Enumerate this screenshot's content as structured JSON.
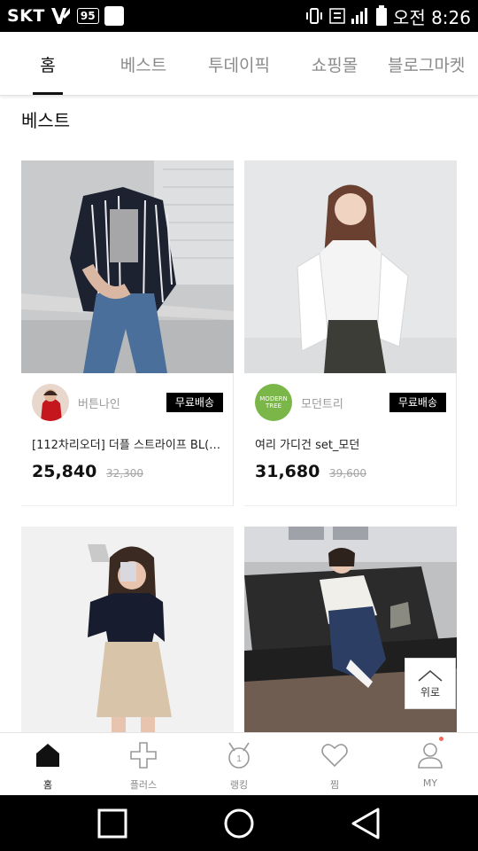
{
  "status_bar": {
    "carrier": "SKT",
    "badge": "95",
    "time": "오전 8:26"
  },
  "tabs": [
    {
      "label": "홈",
      "active": true
    },
    {
      "label": "베스트",
      "active": false
    },
    {
      "label": "투데이픽",
      "active": false
    },
    {
      "label": "쇼핑몰",
      "active": false
    },
    {
      "label": "블로그마켓",
      "active": false
    }
  ],
  "section": {
    "title": "베스트"
  },
  "products": [
    {
      "store": "버튼나인",
      "shipping": "무료배송",
      "name": "[112차리오더] 더플 스트라이프 BL(자…",
      "price": "25,840",
      "original_price": "32,300"
    },
    {
      "store": "모던트리",
      "store_logo_text": "MODERN TREE",
      "shipping": "무료배송",
      "name": "여리 가디건 set_모던",
      "price": "31,680",
      "original_price": "39,600"
    }
  ],
  "to_top": {
    "label": "위로"
  },
  "bottom_nav": [
    {
      "label": "홈",
      "icon": "home-icon",
      "active": true
    },
    {
      "label": "플러스",
      "icon": "plus-icon",
      "active": false
    },
    {
      "label": "랭킹",
      "icon": "ranking-medal-icon",
      "active": false,
      "medal_number": "1"
    },
    {
      "label": "찜",
      "icon": "heart-icon",
      "active": false
    },
    {
      "label": "MY",
      "icon": "person-icon",
      "active": false,
      "has_notification": true
    }
  ],
  "colors": {
    "accent": "#111111",
    "inactive_tab": "#8b8b8b",
    "notification_dot": "#f26b5a",
    "store_green": "#7ab648"
  }
}
